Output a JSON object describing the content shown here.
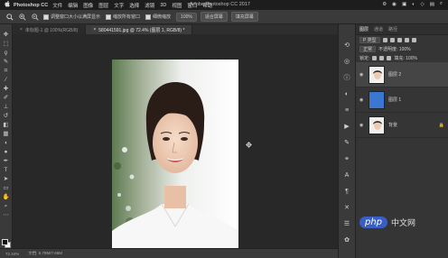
{
  "menubar": {
    "apple": "",
    "app": "Photoshop CC",
    "items": [
      "文件",
      "编辑",
      "图像",
      "图层",
      "文字",
      "选择",
      "滤镜",
      "3D",
      "视图",
      "窗口",
      "帮助"
    ],
    "window_title": "Adobe Photoshop CC 2017",
    "status_icons": [
      "⚙",
      "◉",
      "▣",
      "◐",
      "◇",
      "▤",
      "⌕"
    ]
  },
  "options": {
    "tool_icon": "zoom-icon",
    "check1_label": "调整窗口大小以满屏显示",
    "check2_label": "缩放所有窗口",
    "check3_label": "细微缩放",
    "zoom_value": "100%",
    "fit_button": "适合屏幕",
    "fill_button": "填充屏幕"
  },
  "tabs": [
    {
      "label": "未标题-1 @ 100%(RGB/8)",
      "active": false
    },
    {
      "label": "580441591.jpg @ 72.4% (图层 1, RGB/8) *",
      "active": true
    }
  ],
  "status": {
    "zoom": "72.44%",
    "doc": "文档: 6.78M/7.66M"
  },
  "layers_panel": {
    "tabs": [
      "图层",
      "通道",
      "路径"
    ],
    "kind_label": "P 类型",
    "blend_mode": "正常",
    "opacity_label": "不透明度: 100%",
    "lock_label": "锁定:",
    "fill_label": "填充: 100%",
    "layers": [
      {
        "name": "图层 2",
        "thumb": "photo",
        "active": true,
        "lock": ""
      },
      {
        "name": "图层 1",
        "thumb": "blue",
        "active": false,
        "lock": ""
      },
      {
        "name": "背景",
        "thumb": "photo",
        "active": false,
        "lock": "🔒"
      }
    ]
  },
  "watermark": {
    "logo": "php",
    "text": "中文网"
  },
  "colors": {
    "accent": "#3b76d1",
    "watermark_blue": "#3a5fc4"
  }
}
